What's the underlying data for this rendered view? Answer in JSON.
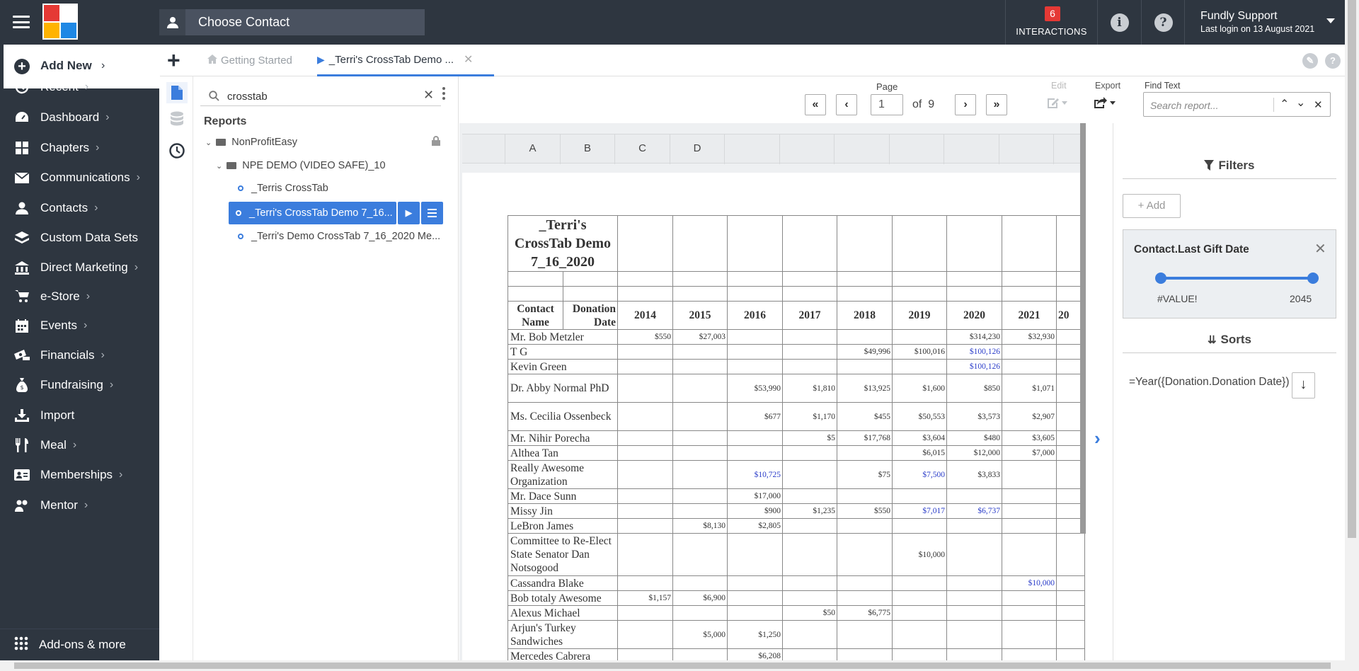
{
  "app": {
    "contact_placeholder": "Choose Contact",
    "interactions_count": "6",
    "interactions_label": "INTERACTIONS",
    "user_name": "Fundly Support",
    "user_last_login": "Last login on 13 August 2021"
  },
  "sidebar": {
    "add_new": "Add New",
    "items": [
      {
        "label": "Recent",
        "icon": "history-icon"
      },
      {
        "label": "Dashboard",
        "icon": "dashboard-icon"
      },
      {
        "label": "Chapters",
        "icon": "grid-icon"
      },
      {
        "label": "Communications",
        "icon": "mail-icon"
      },
      {
        "label": "Contacts",
        "icon": "person-icon"
      },
      {
        "label": "Custom Data Sets",
        "icon": "layers-icon"
      },
      {
        "label": "Direct Marketing",
        "icon": "bank-icon"
      },
      {
        "label": "e-Store",
        "icon": "cart-icon"
      },
      {
        "label": "Events",
        "icon": "calendar-icon"
      },
      {
        "label": "Financials",
        "icon": "money-icon"
      },
      {
        "label": "Fundraising",
        "icon": "bag-icon"
      },
      {
        "label": "Import",
        "icon": "download-icon"
      },
      {
        "label": "Meal",
        "icon": "fork-icon"
      },
      {
        "label": "Memberships",
        "icon": "card-icon"
      },
      {
        "label": "Mentor",
        "icon": "mentor-icon"
      }
    ],
    "addons": "Add-ons & more"
  },
  "tabs": {
    "tab1": "Getting Started",
    "tab2": "_Terri's CrossTab Demo ..."
  },
  "tree": {
    "search_value": "crosstab",
    "reports_header": "Reports",
    "folder1": "NonProfitEasy",
    "folder2": "NPE DEMO (VIDEO SAFE)_10",
    "item1": "_Terris CrossTab",
    "item2": "_Terri's CrossTab Demo 7_16...",
    "item3": "_Terri's Demo CrossTab 7_16_2020 Me..."
  },
  "toolbar": {
    "page_label": "Page",
    "page_value": "1",
    "of_label": "of",
    "total_pages": "9",
    "edit_label": "Edit",
    "export_label": "Export",
    "find_label": "Find Text",
    "find_placeholder": "Search report..."
  },
  "sheet": {
    "columns": [
      "A",
      "B",
      "C",
      "D",
      "",
      "",
      "",
      "",
      "",
      "",
      ""
    ],
    "title": "_Terri's CrossTab Demo 7_16_2020",
    "hdr_contact": "Contact Name",
    "hdr_donation": "Donation Date",
    "years": [
      "2014",
      "2015",
      "2016",
      "2017",
      "2018",
      "2019",
      "2020",
      "2021",
      "20"
    ],
    "rows": [
      {
        "name": "Mr. Bob Metzler",
        "v": [
          "$550",
          "$27,003",
          "",
          "",
          "",
          "",
          "$314,230",
          "$32,930"
        ],
        "blue": []
      },
      {
        "name": "T G",
        "v": [
          "",
          "",
          "",
          "",
          "$49,996",
          "$100,016",
          "$100,126",
          ""
        ],
        "blue": [
          6
        ]
      },
      {
        "name": "Kevin Green",
        "v": [
          "",
          "",
          "",
          "",
          "",
          "",
          "$100,126",
          ""
        ],
        "blue": [
          6
        ]
      },
      {
        "name": "Dr. Abby Normal PhD",
        "v": [
          "",
          "",
          "$53,990",
          "$1,810",
          "$13,925",
          "$1,600",
          "$850",
          "$1,071"
        ],
        "blue": []
      },
      {
        "name": "Ms. Cecilia Ossenbeck",
        "v": [
          "",
          "",
          "$677",
          "$1,170",
          "$455",
          "$50,553",
          "$3,573",
          "$2,907"
        ],
        "blue": []
      },
      {
        "name": "Mr. Nihir Porecha",
        "v": [
          "",
          "",
          "",
          "$5",
          "$17,768",
          "$3,604",
          "$480",
          "$3,605"
        ],
        "blue": []
      },
      {
        "name": "Althea Tan",
        "v": [
          "",
          "",
          "",
          "",
          "",
          "$6,015",
          "$12,000",
          "$7,000"
        ],
        "blue": []
      },
      {
        "name": "Really Awesome Organization",
        "v": [
          "",
          "",
          "$10,725",
          "",
          "$75",
          "$7,500",
          "$3,833",
          ""
        ],
        "blue": [
          2,
          5
        ]
      },
      {
        "name": "Mr. Dace Sunn",
        "v": [
          "",
          "",
          "$17,000",
          "",
          "",
          "",
          "",
          ""
        ],
        "blue": []
      },
      {
        "name": "Missy Jin",
        "v": [
          "",
          "",
          "$900",
          "$1,235",
          "$550",
          "$7,017",
          "$6,737",
          ""
        ],
        "blue": [
          5,
          6
        ]
      },
      {
        "name": "LeBron James",
        "v": [
          "",
          "$8,130",
          "$2,805",
          "",
          "",
          "",
          "",
          ""
        ],
        "blue": []
      },
      {
        "name": "Committee to Re-Elect State Senator Dan Notsogood",
        "v": [
          "",
          "",
          "",
          "",
          "",
          "$10,000",
          "",
          ""
        ],
        "blue": []
      },
      {
        "name": "Cassandra Blake",
        "v": [
          "",
          "",
          "",
          "",
          "",
          "",
          "",
          "$10,000"
        ],
        "blue": [
          7
        ]
      },
      {
        "name": "Bob totaly Awesome",
        "v": [
          "$1,157",
          "$6,900",
          "",
          "",
          "",
          "",
          "",
          ""
        ],
        "blue": []
      },
      {
        "name": "Alexus Michael",
        "v": [
          "",
          "",
          "",
          "$50",
          "$6,775",
          "",
          "",
          ""
        ],
        "blue": []
      },
      {
        "name": "Arjun's Turkey Sandwiches",
        "v": [
          "",
          "$5,000",
          "$1,250",
          "",
          "",
          "",
          "",
          ""
        ],
        "blue": []
      },
      {
        "name": "Mercedes Cabrera",
        "v": [
          "",
          "",
          "$6,208",
          "",
          "",
          "",
          "",
          ""
        ],
        "blue": []
      }
    ]
  },
  "filters": {
    "title": "Filters",
    "add": "+ Add",
    "card_title": "Contact.Last Gift Date",
    "range_low": "#VALUE!",
    "range_high": "2045",
    "sorts_title": "Sorts",
    "sort_expr": "=Year({Donation.Donation Date})"
  }
}
